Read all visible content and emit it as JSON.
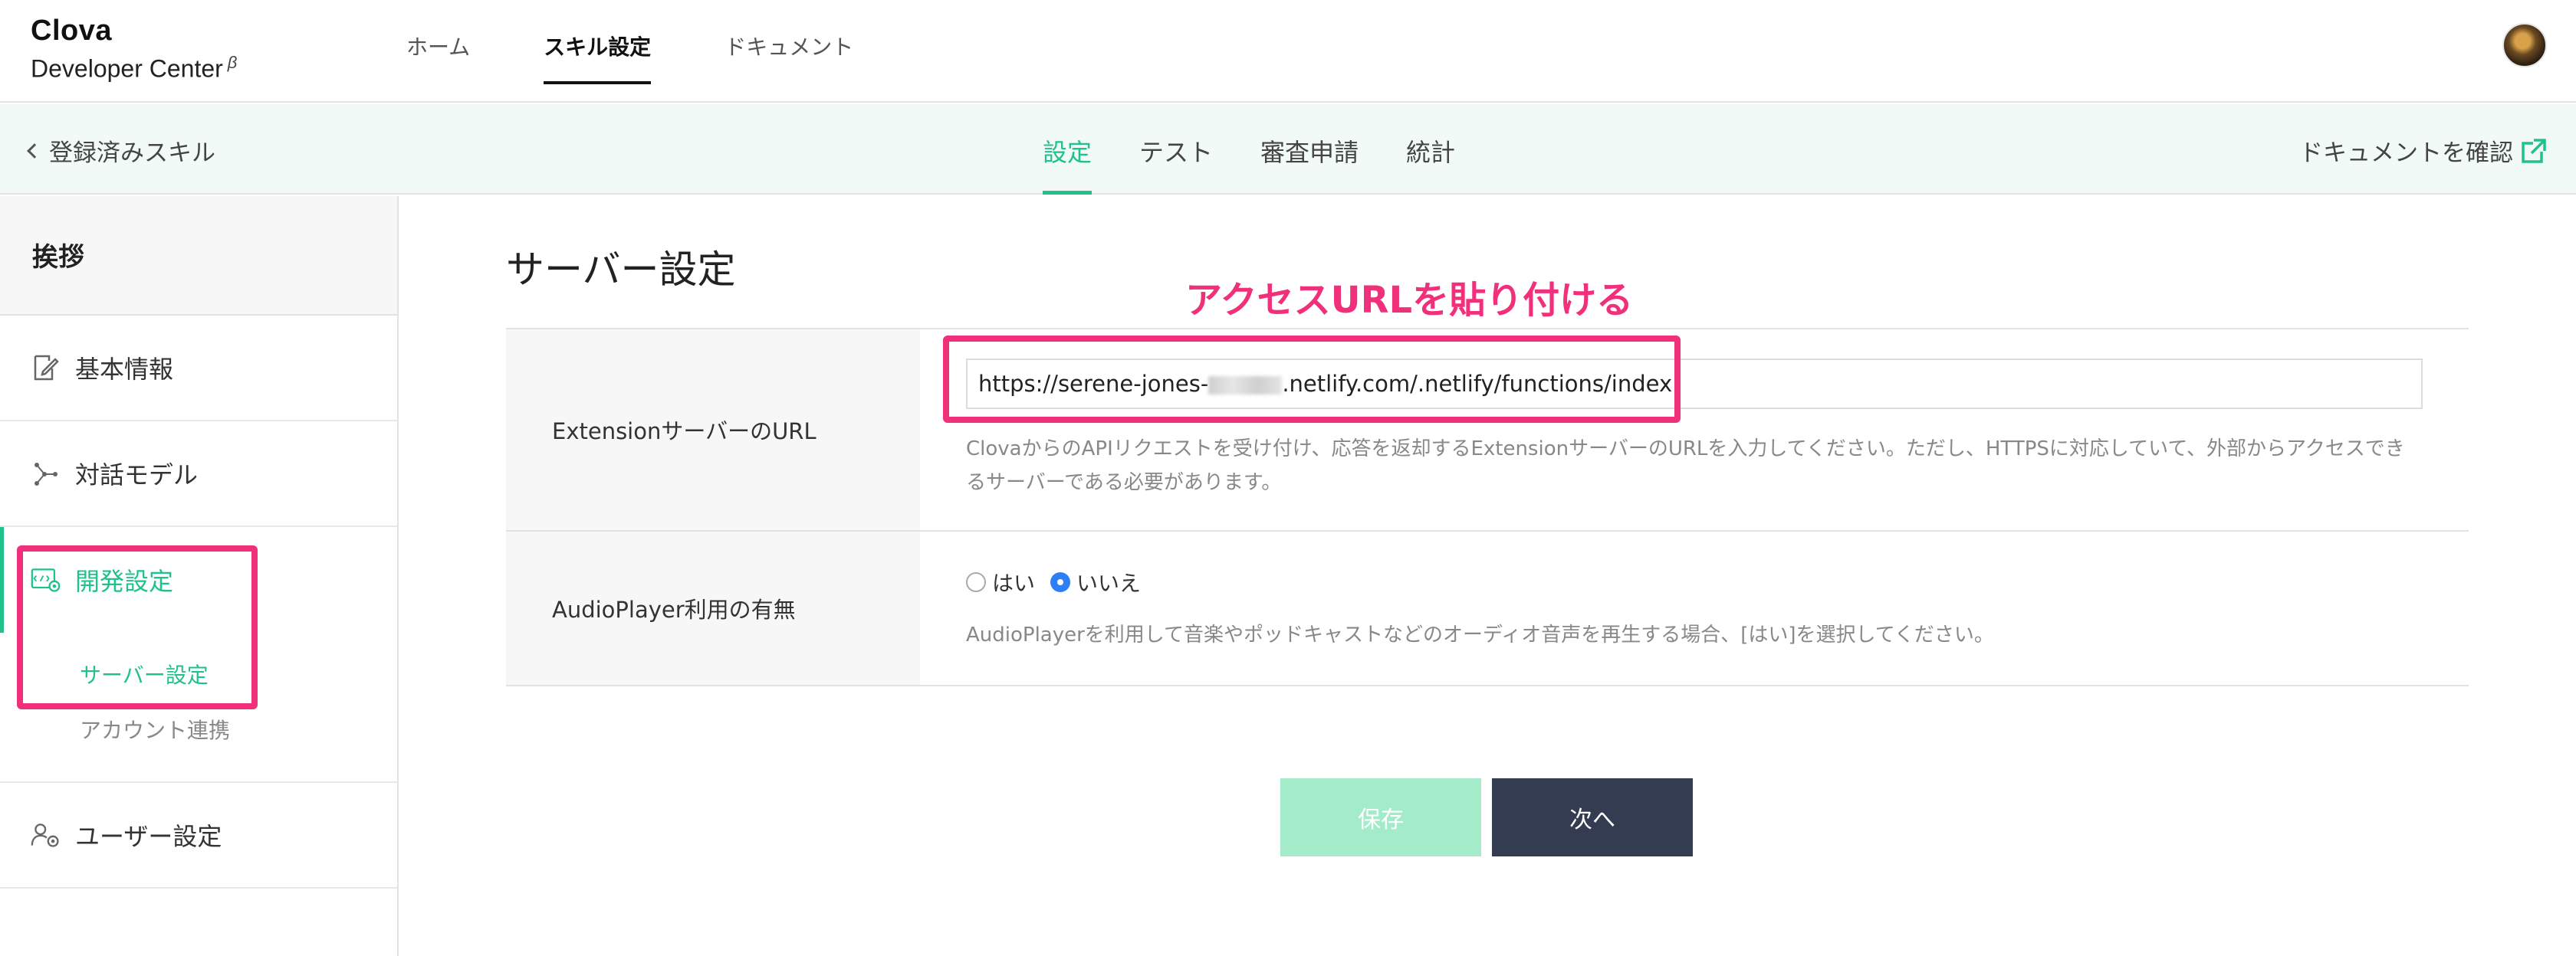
{
  "app": {
    "logo_line1": "Clova",
    "logo_line2": "Developer Center",
    "logo_beta": "β"
  },
  "topnav": {
    "items": [
      {
        "label": "ホーム"
      },
      {
        "label": "スキル設定"
      },
      {
        "label": "ドキュメント"
      }
    ],
    "active": "スキル設定"
  },
  "subnav": {
    "back_label": "登録済みスキル",
    "tabs": [
      {
        "label": "設定"
      },
      {
        "label": "テスト"
      },
      {
        "label": "審査申請"
      },
      {
        "label": "統計"
      }
    ],
    "active": "設定",
    "doc_link": "ドキュメントを確認"
  },
  "sidebar": {
    "title": "挨拶",
    "items": [
      {
        "label": "基本情報",
        "icon": "edit-icon"
      },
      {
        "label": "対話モデル",
        "icon": "network-icon"
      },
      {
        "label": "開発設定",
        "icon": "code-gear-icon"
      },
      {
        "label": "ユーザー設定",
        "icon": "user-gear-icon"
      }
    ],
    "subitems": [
      {
        "label": "サーバー設定"
      },
      {
        "label": "アカウント連携"
      }
    ]
  },
  "main": {
    "title": "サーバー設定",
    "annotation": "アクセスURLを貼り付ける",
    "extension": {
      "label": "ExtensionサーバーのURL",
      "url_prefix": "https://serene-jones-",
      "url_suffix": ".netlify.com/.netlify/functions/index",
      "help_line1": "ClovaからのAPIリクエストを受け付け、応答を返却するExtensionサーバーのURLを入力してください。ただし、HTTPSに対応していて、外部からアクセスでき",
      "help_line2": "るサーバーである必要があります。"
    },
    "audioplayer": {
      "label": "AudioPlayer利用の有無",
      "option_yes": "はい",
      "option_no": "いいえ",
      "selected": "いいえ",
      "help": "AudioPlayerを利用して音楽やポッドキャストなどのオーディオ音声を再生する場合、[はい]を選択してください。"
    },
    "save_label": "保存",
    "next_label": "次へ"
  },
  "colors": {
    "accent": "#1fc38a",
    "highlight": "#f0307a",
    "save_disabled": "#a4ecc9",
    "next_bg": "#333c50"
  }
}
